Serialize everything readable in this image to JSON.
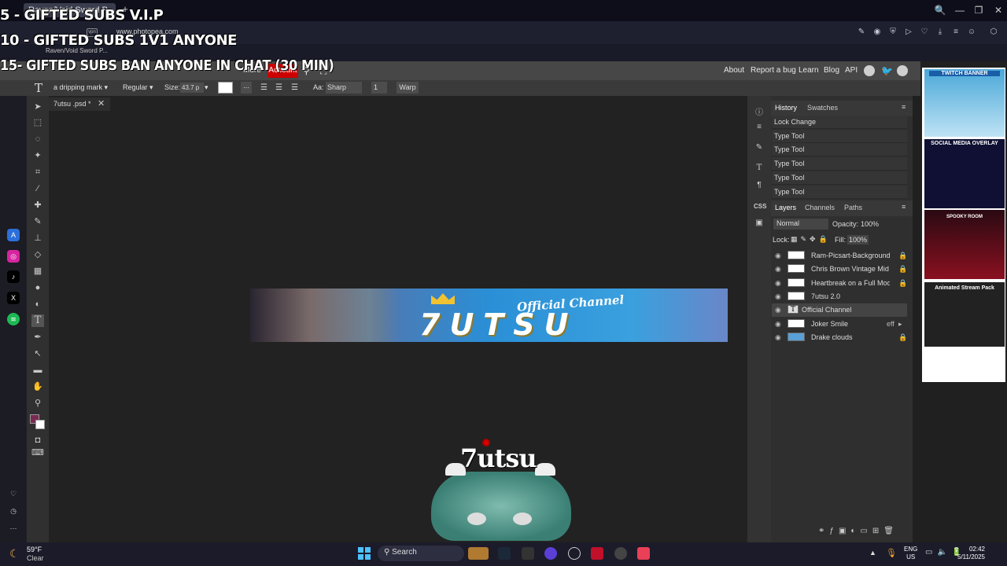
{
  "browser": {
    "tab_label": "Raven/Void Sword P...",
    "new_tab_glyph": "+",
    "url": "www.photopea.com",
    "url_badge": "vpn",
    "bookmark": "Raven/Void Sword P...",
    "window_controls": [
      "🔍",
      "—",
      "❐",
      "✕"
    ]
  },
  "overlay": {
    "line1": "5 - GIFTED SUBS V.I.P",
    "line2": "10 - GIFTED SUBS 1V1 ANYONE",
    "line3": "15- GIFTED SUBS BAN ANYONE IN CHAT (30 MIN)"
  },
  "menubar": {
    "more": "More",
    "account": "Account",
    "about": "About",
    "report_bug": "Report a bug",
    "learn": "Learn",
    "blog": "Blog",
    "api": "API"
  },
  "options": {
    "font": "a dripping mark",
    "style": "Regular",
    "size_label": "Size:",
    "size_value": "43.7 p",
    "extra": "...",
    "aa_label": "Aa:",
    "aa_value": "Sharp",
    "tracking": "1",
    "warp": "Warp"
  },
  "document": {
    "tab_name": "7utsu .psd *",
    "banner_title": "Official Channel",
    "banner_logo": "7UTSU"
  },
  "history": {
    "tabs": [
      "History",
      "Swatches"
    ],
    "items": [
      "Lock Change",
      "Type Tool",
      "Type Tool",
      "Type Tool",
      "Type Tool",
      "Type Tool"
    ]
  },
  "layers": {
    "tabs": [
      "Layers",
      "Channels",
      "Paths"
    ],
    "blend": "Normal",
    "opacity_label": "Opacity:",
    "opacity": "100%",
    "lock_label": "Lock:",
    "fill_label": "Fill:",
    "fill": "100%",
    "items": [
      {
        "name": "Ram-Picsart-Background",
        "locked": true
      },
      {
        "name": "Chris Brown Vintage Mid",
        "locked": true
      },
      {
        "name": "Heartbreak on a Full Moo",
        "locked": true
      },
      {
        "name": "7utsu 2.0",
        "locked": false
      },
      {
        "name": "Official Channel",
        "locked": false,
        "type": "text",
        "selected": true
      },
      {
        "name": "Joker Smile",
        "locked": false,
        "effect": "eff"
      },
      {
        "name": "Drake clouds",
        "locked": true
      }
    ]
  },
  "ads": {
    "items": [
      "TWITCH BANNER",
      "SOCIAL MEDIA OVERLAY",
      "SPOOKY ROOM",
      "Animated Stream Pack"
    ]
  },
  "controller": {
    "brand": "7utsu"
  },
  "taskbar": {
    "weather_temp": "59°F",
    "weather_desc": "Clear",
    "search": "Search",
    "lang_top": "ENG",
    "lang_bottom": "US",
    "time": "02:42",
    "date": "5/11/2025"
  },
  "colors": {
    "accent_account": "#cc0000",
    "menubar": "#474747",
    "panel_bg": "#2f2f2f"
  }
}
